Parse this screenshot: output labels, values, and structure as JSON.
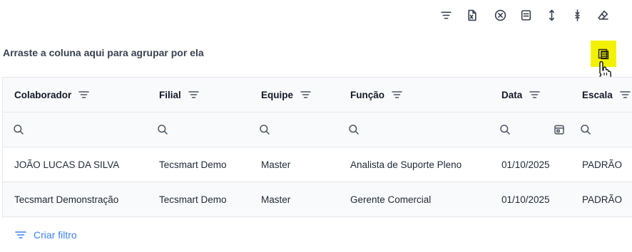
{
  "toolbar": {
    "icons": [
      "filter-icon",
      "export-excel-icon",
      "clear-filter-icon",
      "column-chooser-icon",
      "row-height-icon",
      "compact-icon",
      "eraser-icon"
    ]
  },
  "group_panel": {
    "text": "Arraste a coluna aqui para agrupar por ela"
  },
  "colors": {
    "highlight": "#f2f200",
    "accent": "#3b82f6"
  },
  "table": {
    "columns": [
      "Colaborador",
      "Filial",
      "Equipe",
      "Função",
      "Data",
      "Escala"
    ],
    "rows": [
      [
        "JOÃO LUCAS DA SILVA",
        "Tecsmart Demo",
        "Master",
        "Analista de Suporte Pleno",
        "01/10/2025",
        "PADRÃO"
      ],
      [
        "Tecsmart Demonstração",
        "Tecsmart Demo",
        "Master",
        "Gerente Comercial",
        "01/10/2025",
        "PADRÃO"
      ]
    ]
  },
  "footer": {
    "create_filter": "Criar filtro"
  }
}
